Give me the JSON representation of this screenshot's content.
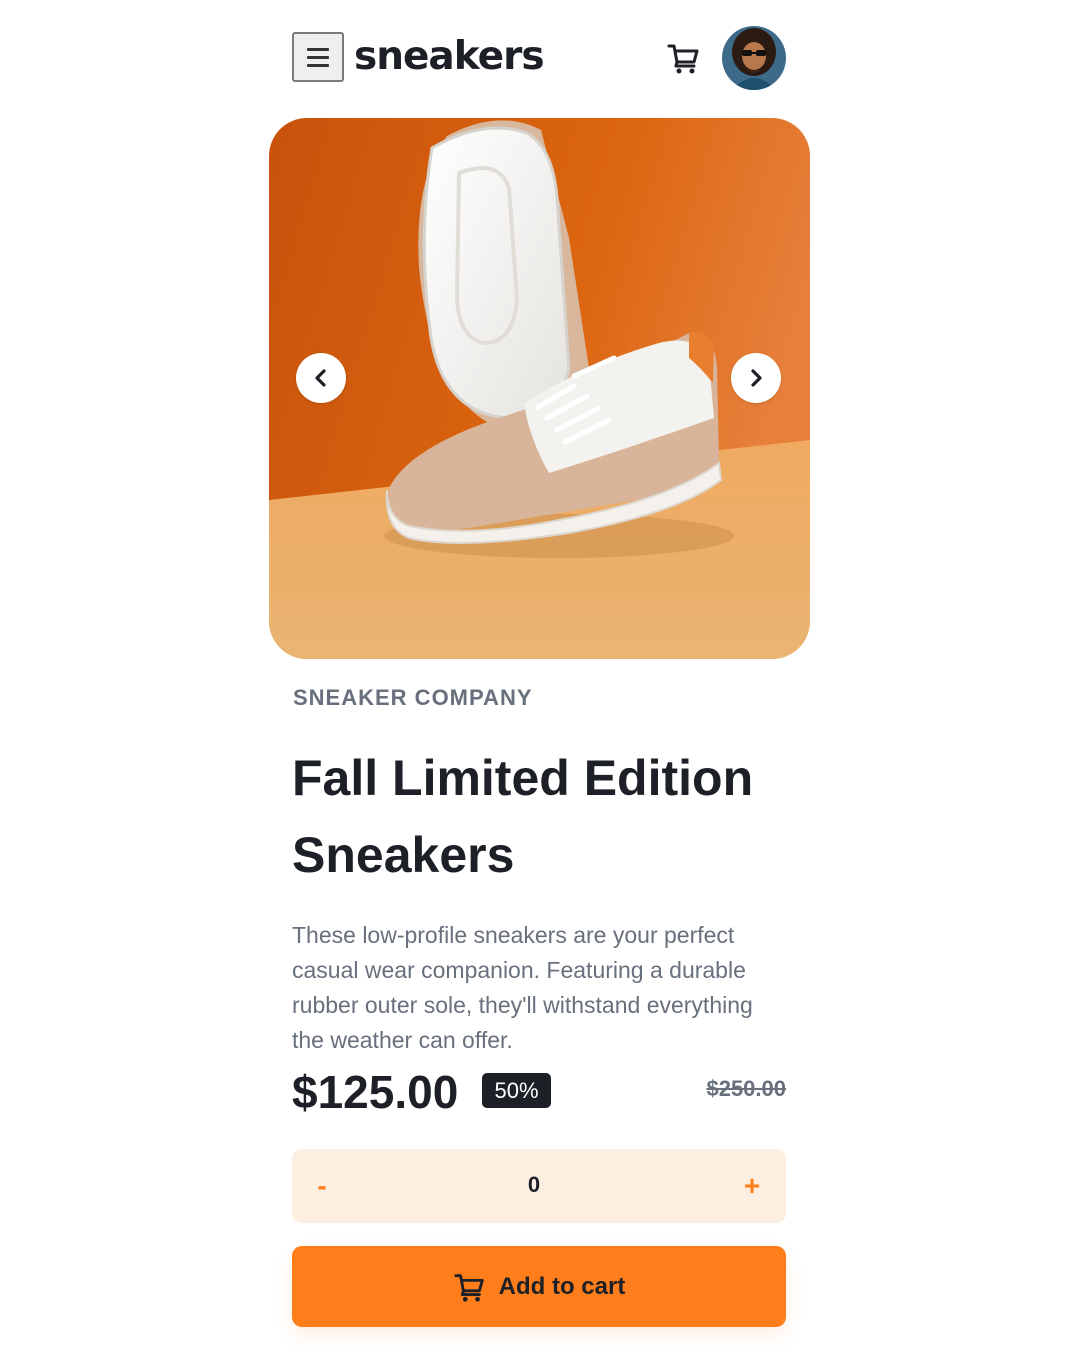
{
  "header": {
    "logo": "sneakers",
    "menu_icon": "hamburger-menu-icon",
    "cart_icon": "cart-icon",
    "avatar_icon": "user-avatar"
  },
  "gallery": {
    "image_subject": "white and beige low-profile sneakers on orange background",
    "prev_icon": "chevron-left-icon",
    "next_icon": "chevron-right-icon"
  },
  "product": {
    "company": "SNEAKER COMPANY",
    "title_line1": "Fall Limited Edition",
    "title_line2": "Sneakers",
    "description": "These low-profile sneakers are your perfect casual wear companion. Featuring a durable rubber outer sole, they'll withstand everything the weather can offer.",
    "price": "$125.00",
    "discount": "50%",
    "original_price": "$250.00"
  },
  "quantity": {
    "minus_label": "-",
    "value": "0",
    "plus_label": "+"
  },
  "cart_button": {
    "label": "Add to cart",
    "icon": "cart-icon"
  },
  "colors": {
    "accent": "#ff7e1b",
    "accent_pale": "#fdeee2",
    "text_dark": "#1d2026",
    "text_gray": "#68707d"
  }
}
